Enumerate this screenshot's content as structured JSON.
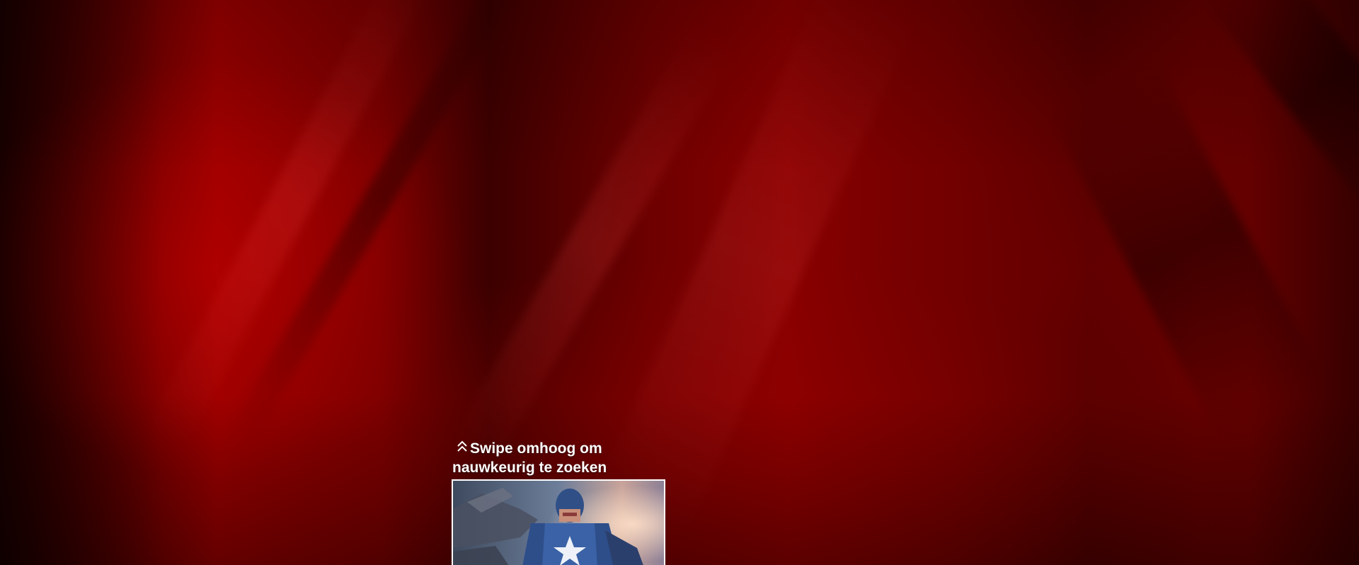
{
  "swipe_hint": {
    "icon": "double-chevron-up-icon",
    "line1": "Swipe omhoog om",
    "line2": "nauwkeurig te zoeken"
  },
  "thumbnail": {
    "subject": "superhero-in-star-suit-image"
  },
  "colors": {
    "background_accent": "#8a0000",
    "text": "#ffffff",
    "thumbnail_border": "#ffffff"
  }
}
